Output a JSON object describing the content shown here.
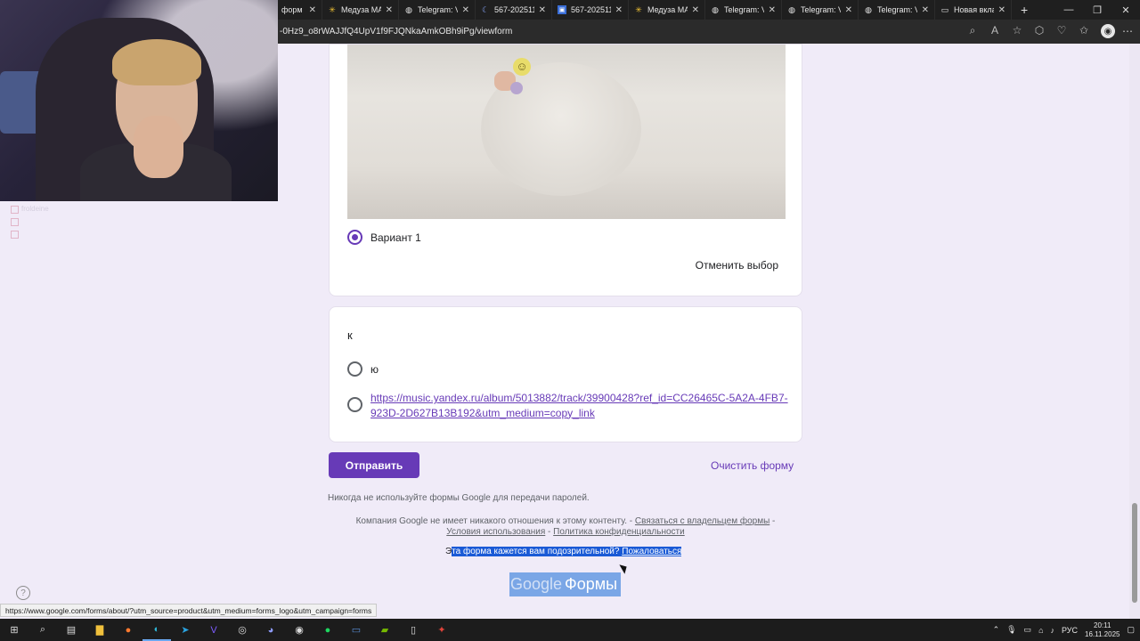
{
  "browser": {
    "tabs": [
      {
        "label": "форм",
        "icon": "forms-icon"
      },
      {
        "label": "Медуза МАТ",
        "icon": "meduza-icon"
      },
      {
        "label": "Telegram: Vi",
        "icon": "globe-icon"
      },
      {
        "label": "567-202511(",
        "icon": "moon-icon"
      },
      {
        "label": "567-202511(",
        "icon": "image-icon"
      },
      {
        "label": "Медуза МАТ",
        "icon": "meduza-icon"
      },
      {
        "label": "Telegram: Vi",
        "icon": "globe-icon"
      },
      {
        "label": "Telegram: Vi",
        "icon": "globe-icon"
      },
      {
        "label": "Telegram: Vi",
        "icon": "globe-icon"
      },
      {
        "label": "Новая вклад",
        "icon": "newtab-icon"
      }
    ],
    "url": "-0Hz9_o8rWAJJfQ4UpV1f9FJQNkaAmkOBh9iPg/viewform"
  },
  "chat": {
    "lines": [
      "froldeine",
      "",
      ""
    ]
  },
  "form": {
    "option_selected": "Вариант 1",
    "clear_choice": "Отменить выбор",
    "question": "к",
    "options": [
      "ю",
      "https://music.yandex.ru/album/5013882/track/39900428?ref_id=CC26465C-5A2A-4FB7-923D-2D627B13B192&utm_medium=copy_link"
    ],
    "submit": "Отправить",
    "clear_form": "Очистить форму"
  },
  "footer": {
    "never_passwords": "Никогда не используйте формы Google для передачи паролей.",
    "disclaimer": "Компания Google не имеет никакого отношения к этому контенту. -",
    "contact_owner": "Связаться с владельцем формы",
    "terms": "Условия использования",
    "privacy": "Политика конфиденциальности",
    "report_prefix": "Э",
    "report_question": "та форма кажется вам подозрительной?",
    "report_link": "Пожаловаться",
    "logo_google": "Google",
    "logo_forms": "Формы"
  },
  "status_url": "https://www.google.com/forms/about/?utm_source=product&utm_medium=forms_logo&utm_campaign=forms",
  "taskbar": {
    "lang": "РУС",
    "time": "20:11",
    "date": "16.11.2025"
  }
}
